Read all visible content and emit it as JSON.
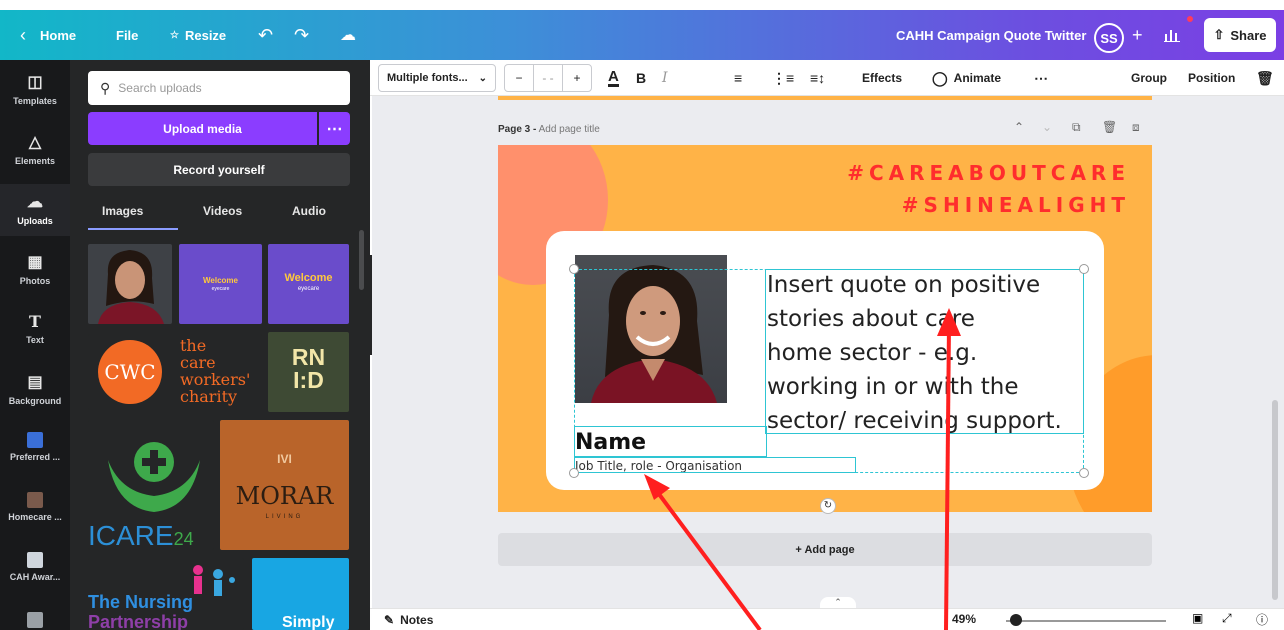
{
  "topbar": {
    "home": "Home",
    "file": "File",
    "resize": "Resize",
    "title": "CAHH Campaign Quote Twitter",
    "avatar": "SS",
    "share": "Share"
  },
  "rail": {
    "items": [
      "Templates",
      "Elements",
      "Uploads",
      "Photos",
      "Text",
      "Background",
      "Preferred ...",
      "Homecare ...",
      "CAH Awar..."
    ]
  },
  "panel": {
    "search_placeholder": "Search uploads",
    "upload_media": "Upload media",
    "record": "Record yourself",
    "tabs": [
      "Images",
      "Videos",
      "Audio"
    ],
    "thumbs": {
      "welcome1": "Welcome",
      "welcome1_sub": "eyecare",
      "welcome2": "Welcome",
      "welcome2_sub": "eyecare",
      "cwc": "CWC",
      "cwc_text": [
        "the",
        "care",
        "workers'",
        "charity"
      ],
      "rnid": [
        "RN",
        "I:D"
      ],
      "morar": "MORAR",
      "morar_sub": "LIVING",
      "icare": "ICARE",
      "icare_num": "24",
      "nursing": "The Nursing",
      "nursing2": "Partnership",
      "simply": "Simply"
    }
  },
  "toolbar": {
    "font": "Multiple fonts...",
    "effects": "Effects",
    "animate": "Animate",
    "group": "Group",
    "position": "Position"
  },
  "canvas": {
    "page_prefix": "Page 3 -",
    "page_title_placeholder": "Add page title",
    "hashtag1": "#CAREABOUTCARE",
    "hashtag2": "#SHINEALIGHT",
    "quote_lines": [
      "Insert quote on positive",
      "stories about care",
      "home sector - e.g.",
      "working in or with the",
      "sector/ receiving support."
    ],
    "name": "Name",
    "job": "Job Title, role - Organisation",
    "add_page": "+ Add page"
  },
  "bottombar": {
    "notes": "Notes",
    "zoom": "49%"
  },
  "colors": {
    "accent": "#8b3dff",
    "selection": "#2ec5d3",
    "hashtag": "#ff2d2d",
    "design_bg": "#ffb347",
    "arrow": "#ff1f1f"
  }
}
